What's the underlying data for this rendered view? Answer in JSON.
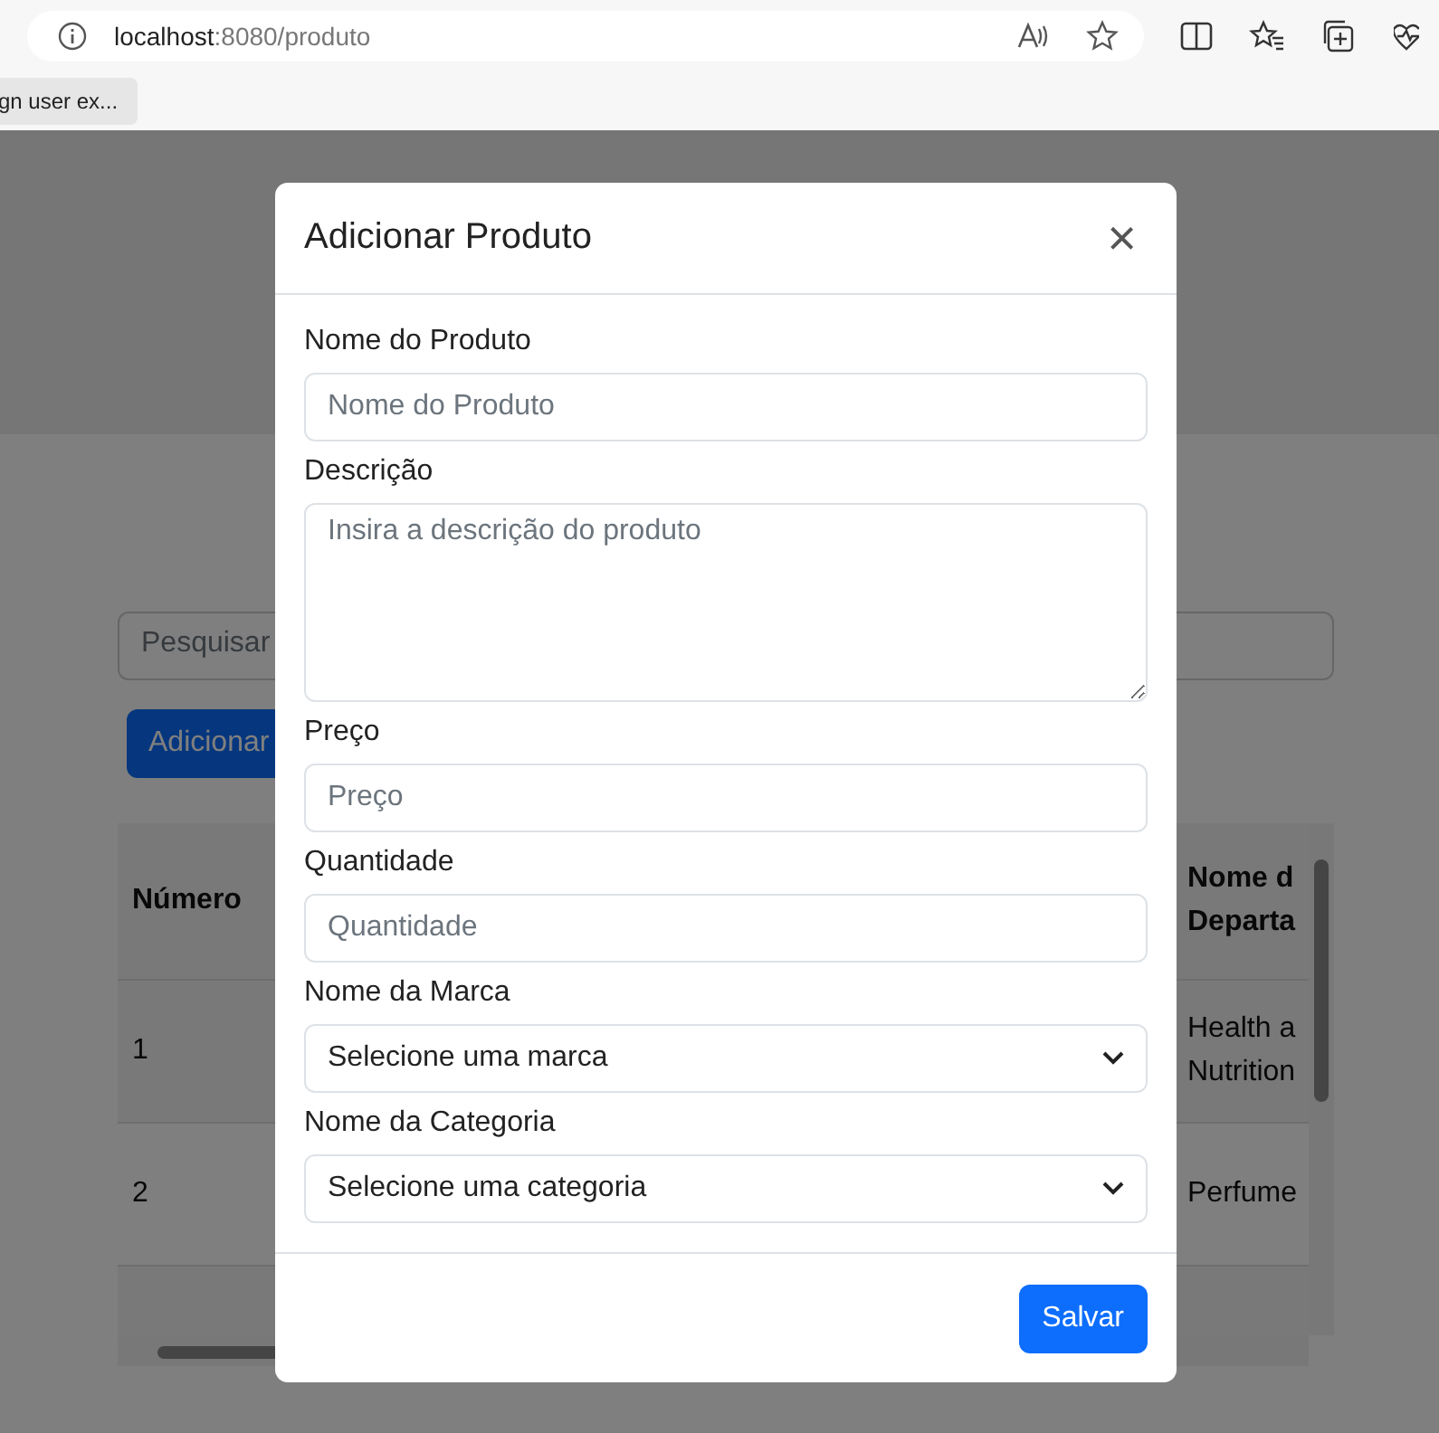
{
  "browser": {
    "url_host": "localhost",
    "url_path": ":8080/produto",
    "bookmarks": [
      "gn user ex..."
    ]
  },
  "page": {
    "search_placeholder": "Pesquisar",
    "add_button": "Adicionar",
    "table": {
      "columns": [
        "Número",
        "",
        "Nome d\nDeparta"
      ],
      "rows": [
        {
          "cells": [
            "1",
            "",
            "Health a\nNutrition"
          ]
        },
        {
          "cells": [
            "2",
            "",
            "Perfume"
          ]
        }
      ]
    }
  },
  "modal": {
    "title": "Adicionar Produto",
    "close": "×",
    "fields": [
      {
        "kind": "input",
        "label": "Nome do Produto",
        "placeholder": "Nome do Produto"
      },
      {
        "kind": "textarea",
        "label": "Descrição",
        "placeholder": "Insira a descrição do produto"
      },
      {
        "kind": "input",
        "label": "Preço",
        "placeholder": "Preço"
      },
      {
        "kind": "input",
        "label": "Quantidade",
        "placeholder": "Quantidade"
      },
      {
        "kind": "select",
        "label": "Nome da Marca",
        "value": "Selecione uma marca"
      },
      {
        "kind": "select",
        "label": "Nome da Categoria",
        "value": "Selecione uma categoria"
      }
    ],
    "save_button": "Salvar"
  }
}
